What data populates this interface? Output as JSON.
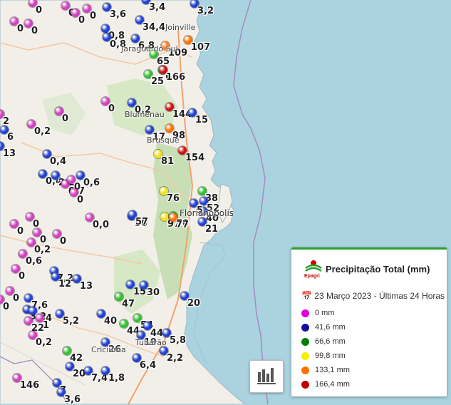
{
  "legend": {
    "title": "Precipitação Total (mm)",
    "logo_text": "Epagri",
    "date": "23 Março 2023 - Últimas 24 Horas",
    "items": [
      {
        "label": "0 mm",
        "color": "#e000e0"
      },
      {
        "label": "41,6 mm",
        "color": "#1010a0"
      },
      {
        "label": "66,6 mm",
        "color": "#008000"
      },
      {
        "label": "99,8 mm",
        "color": "#f0f000"
      },
      {
        "label": "133,1 mm",
        "color": "#ff7000"
      },
      {
        "label": "166,4 mm",
        "color": "#c00000"
      }
    ]
  },
  "cities": [
    "Joinville",
    "Jaraguá do Sul",
    "Blumenau",
    "Brusque",
    "Florianópolis",
    "Tubarão",
    "Criciúma"
  ],
  "stations": [
    {
      "v": "0",
      "c": "#d040c0"
    },
    {
      "v": "0",
      "c": "#d040c0"
    },
    {
      "v": "0",
      "c": "#d040c0"
    },
    {
      "v": "0",
      "c": "#d040c0"
    },
    {
      "v": "0",
      "c": "#d040c0"
    },
    {
      "v": "0",
      "c": "#d040c0"
    },
    {
      "v": "3,6",
      "c": "#2040d0"
    },
    {
      "v": "3,4",
      "c": "#2040d0"
    },
    {
      "v": "3,2",
      "c": "#2040d0"
    },
    {
      "v": "34,4",
      "c": "#2040d0"
    },
    {
      "v": "0,8",
      "c": "#2040d0"
    },
    {
      "v": "0,8",
      "c": "#2040d0"
    },
    {
      "v": "6,8",
      "c": "#2040d0"
    },
    {
      "v": "109",
      "c": "#ff7000"
    },
    {
      "v": "107",
      "c": "#ff7000"
    },
    {
      "v": "65",
      "c": "#30c030"
    },
    {
      "v": "25",
      "c": "#30c030"
    },
    {
      "v": "68",
      "c": "#30c030"
    },
    {
      "v": "166",
      "c": "#d01010"
    },
    {
      "v": "0",
      "c": "#d040c0"
    },
    {
      "v": "0,2",
      "c": "#2040d0"
    },
    {
      "v": "144",
      "c": "#d01010"
    },
    {
      "v": "15",
      "c": "#2040d0"
    },
    {
      "v": "2",
      "c": "#d040c0"
    },
    {
      "v": "0",
      "c": "#d040c0"
    },
    {
      "v": "0,2",
      "c": "#d040c0"
    },
    {
      "v": "6",
      "c": "#2040d0"
    },
    {
      "v": "0,4",
      "c": "#2040d0"
    },
    {
      "v": "13",
      "c": "#2040d0"
    },
    {
      "v": "98",
      "c": "#ff7000"
    },
    {
      "v": "17",
      "c": "#2040d0"
    },
    {
      "v": "81",
      "c": "#f0e020"
    },
    {
      "v": "154",
      "c": "#d01010"
    },
    {
      "v": "0,4",
      "c": "#2040d0"
    },
    {
      "v": "2,2",
      "c": "#2040d0"
    },
    {
      "v": "0,7",
      "c": "#d040c0"
    },
    {
      "v": "0,6",
      "c": "#2040d0"
    },
    {
      "v": "0",
      "c": "#d040c0"
    },
    {
      "v": "0",
      "c": "#d040c0"
    },
    {
      "v": "76",
      "c": "#f0e020"
    },
    {
      "v": "38",
      "c": "#30c030"
    },
    {
      "v": "52",
      "c": "#2040d0"
    },
    {
      "v": "40",
      "c": "#2040d0"
    },
    {
      "v": "5",
      "c": "#2040d0"
    },
    {
      "v": "0",
      "c": "#d040c0"
    },
    {
      "v": "0,0",
      "c": "#d040c0"
    },
    {
      "v": "50",
      "c": "#2040d0"
    },
    {
      "v": "57",
      "c": "#2040d0"
    },
    {
      "v": "97",
      "c": "#f0e020"
    },
    {
      "v": "70",
      "c": "#30c030"
    },
    {
      "v": "77",
      "c": "#ff7000"
    },
    {
      "v": "21",
      "c": "#2040d0"
    },
    {
      "v": "0",
      "c": "#d040c0"
    },
    {
      "v": "0",
      "c": "#d040c0"
    },
    {
      "v": "0,2",
      "c": "#d040c0"
    },
    {
      "v": "0",
      "c": "#d040c0"
    },
    {
      "v": "0,6",
      "c": "#d040c0"
    },
    {
      "v": "0",
      "c": "#d040c0"
    },
    {
      "v": "7,2",
      "c": "#2040d0"
    },
    {
      "v": "12",
      "c": "#2040d0"
    },
    {
      "v": "13",
      "c": "#2040d0"
    },
    {
      "v": "0",
      "c": "#d040c0"
    },
    {
      "v": "7,6",
      "c": "#2040d0"
    },
    {
      "v": "0",
      "c": "#d040c0"
    },
    {
      "v": "3,2",
      "c": "#2040d0"
    },
    {
      "v": "6,4",
      "c": "#2040d0"
    },
    {
      "v": "15",
      "c": "#2040d0"
    },
    {
      "v": "30",
      "c": "#2040d0"
    },
    {
      "v": "47",
      "c": "#30c030"
    },
    {
      "v": "20",
      "c": "#2040d0"
    },
    {
      "v": "22",
      "c": "#d040c0"
    },
    {
      "v": "1",
      "c": "#d040c0"
    },
    {
      "v": "5,2",
      "c": "#2040d0"
    },
    {
      "v": "40",
      "c": "#2040d0"
    },
    {
      "v": "54",
      "c": "#30c030"
    },
    {
      "v": "0,2",
      "c": "#d040c0"
    },
    {
      "v": "44",
      "c": "#30c030"
    },
    {
      "v": "44",
      "c": "#2040d0"
    },
    {
      "v": "19",
      "c": "#2040d0"
    },
    {
      "v": "5,8",
      "c": "#2040d0"
    },
    {
      "v": "26",
      "c": "#2040d0"
    },
    {
      "v": "42",
      "c": "#30c030"
    },
    {
      "v": "2,2",
      "c": "#2040d0"
    },
    {
      "v": "20",
      "c": "#2040d0"
    },
    {
      "v": "7,4",
      "c": "#2040d0"
    },
    {
      "v": "1,8",
      "c": "#2040d0"
    },
    {
      "v": "6,4",
      "c": "#2040d0"
    },
    {
      "v": "146",
      "c": "#d040c0"
    },
    {
      "v": "7",
      "c": "#2040d0"
    },
    {
      "v": "3,6",
      "c": "#2040d0"
    }
  ]
}
